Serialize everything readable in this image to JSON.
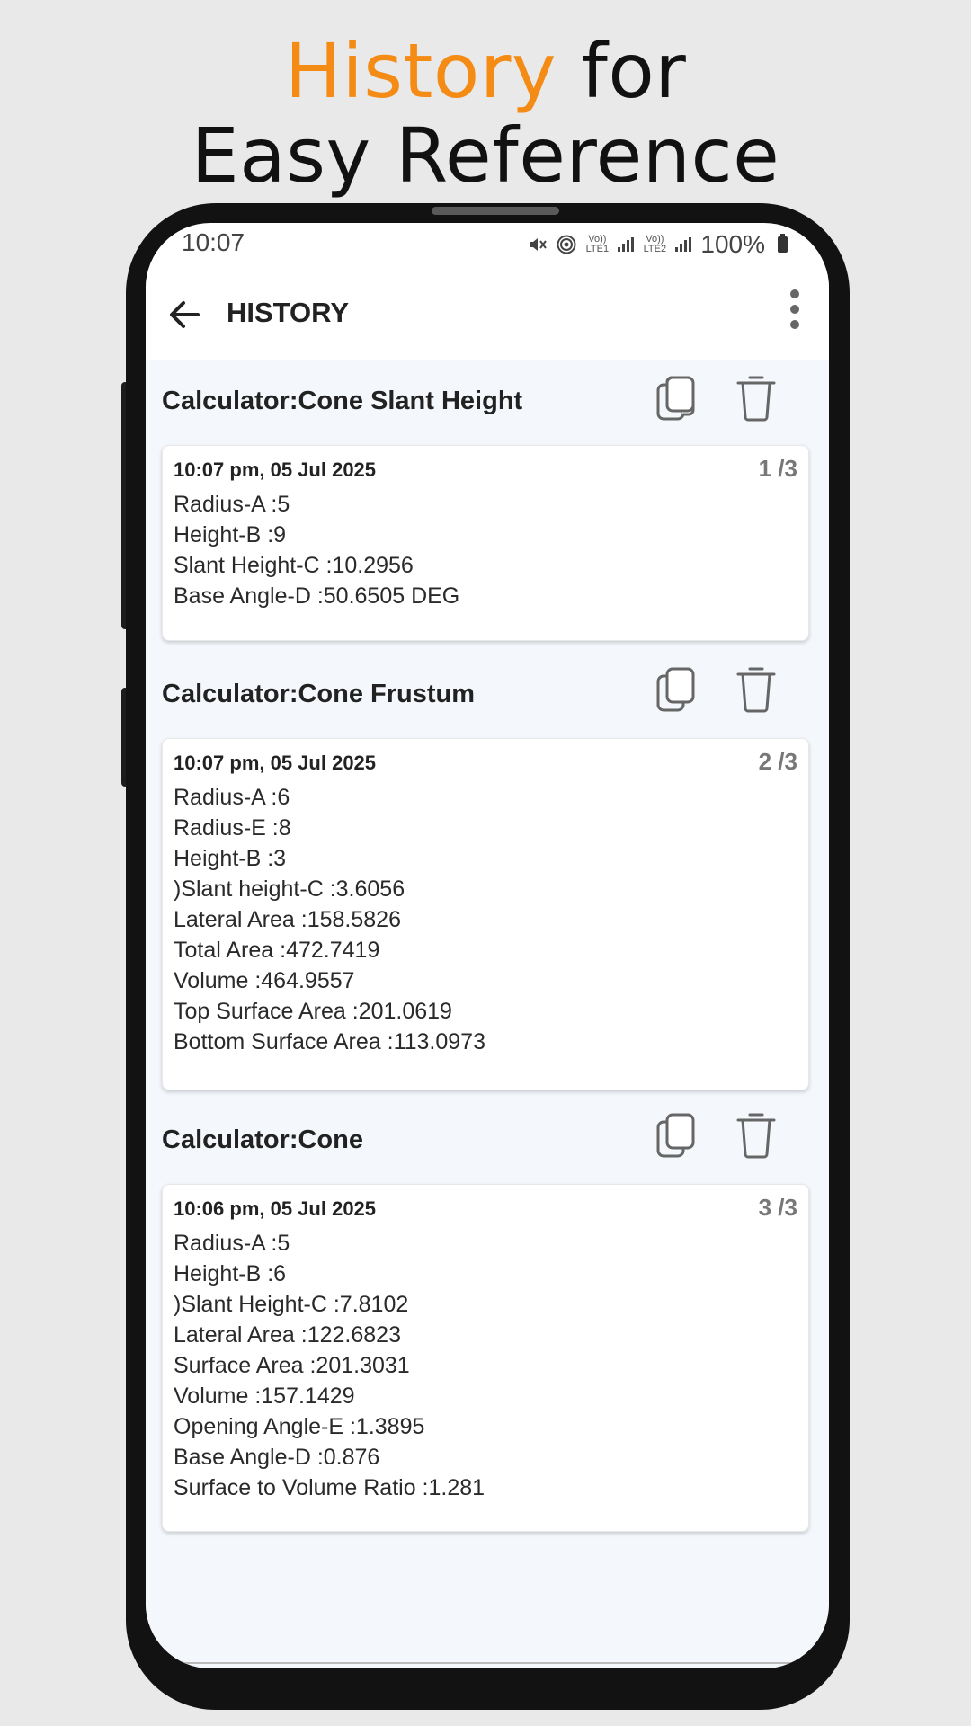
{
  "promo": {
    "accent": "History",
    "line1_rest": " for",
    "line2": "Easy Reference",
    "accent_color": "#f38b14"
  },
  "status_bar": {
    "time": "10:07",
    "sim1": "Vo)) LTE1",
    "sim2": "Vo)) LTE2",
    "battery": "100%"
  },
  "app_bar": {
    "title": "HISTORY",
    "back_icon": "arrow-left-icon",
    "menu_icon": "more-vert-icon"
  },
  "entries": [
    {
      "title": "Calculator:Cone Slant Height",
      "timestamp": "10:07 pm, 05 Jul 2025",
      "page": "1 /3",
      "lines": [
        "Radius-A :5",
        "Height-B :9",
        "Slant Height-C :10.2956",
        "Base Angle-D :50.6505 DEG"
      ]
    },
    {
      "title": "Calculator:Cone Frustum",
      "timestamp": "10:07 pm, 05 Jul 2025",
      "page": "2 /3",
      "lines": [
        "Radius-A :6",
        "Radius-E :8",
        "Height-B :3",
        ")Slant height-C :3.6056",
        "Lateral Area :158.5826",
        "Total Area :472.7419",
        "Volume :464.9557",
        "Top Surface Area :201.0619",
        "Bottom Surface Area :113.0973"
      ]
    },
    {
      "title": "Calculator:Cone",
      "timestamp": "10:06 pm, 05 Jul 2025",
      "page": "3 /3",
      "lines": [
        "Radius-A :5",
        "Height-B :6",
        ")Slant Height-C :7.8102",
        "Lateral Area :122.6823",
        "Surface Area :201.3031",
        "Volume :157.1429",
        "Opening Angle-E :1.3895",
        "Base Angle-D :0.876",
        "Surface to Volume Ratio :1.281"
      ]
    }
  ]
}
